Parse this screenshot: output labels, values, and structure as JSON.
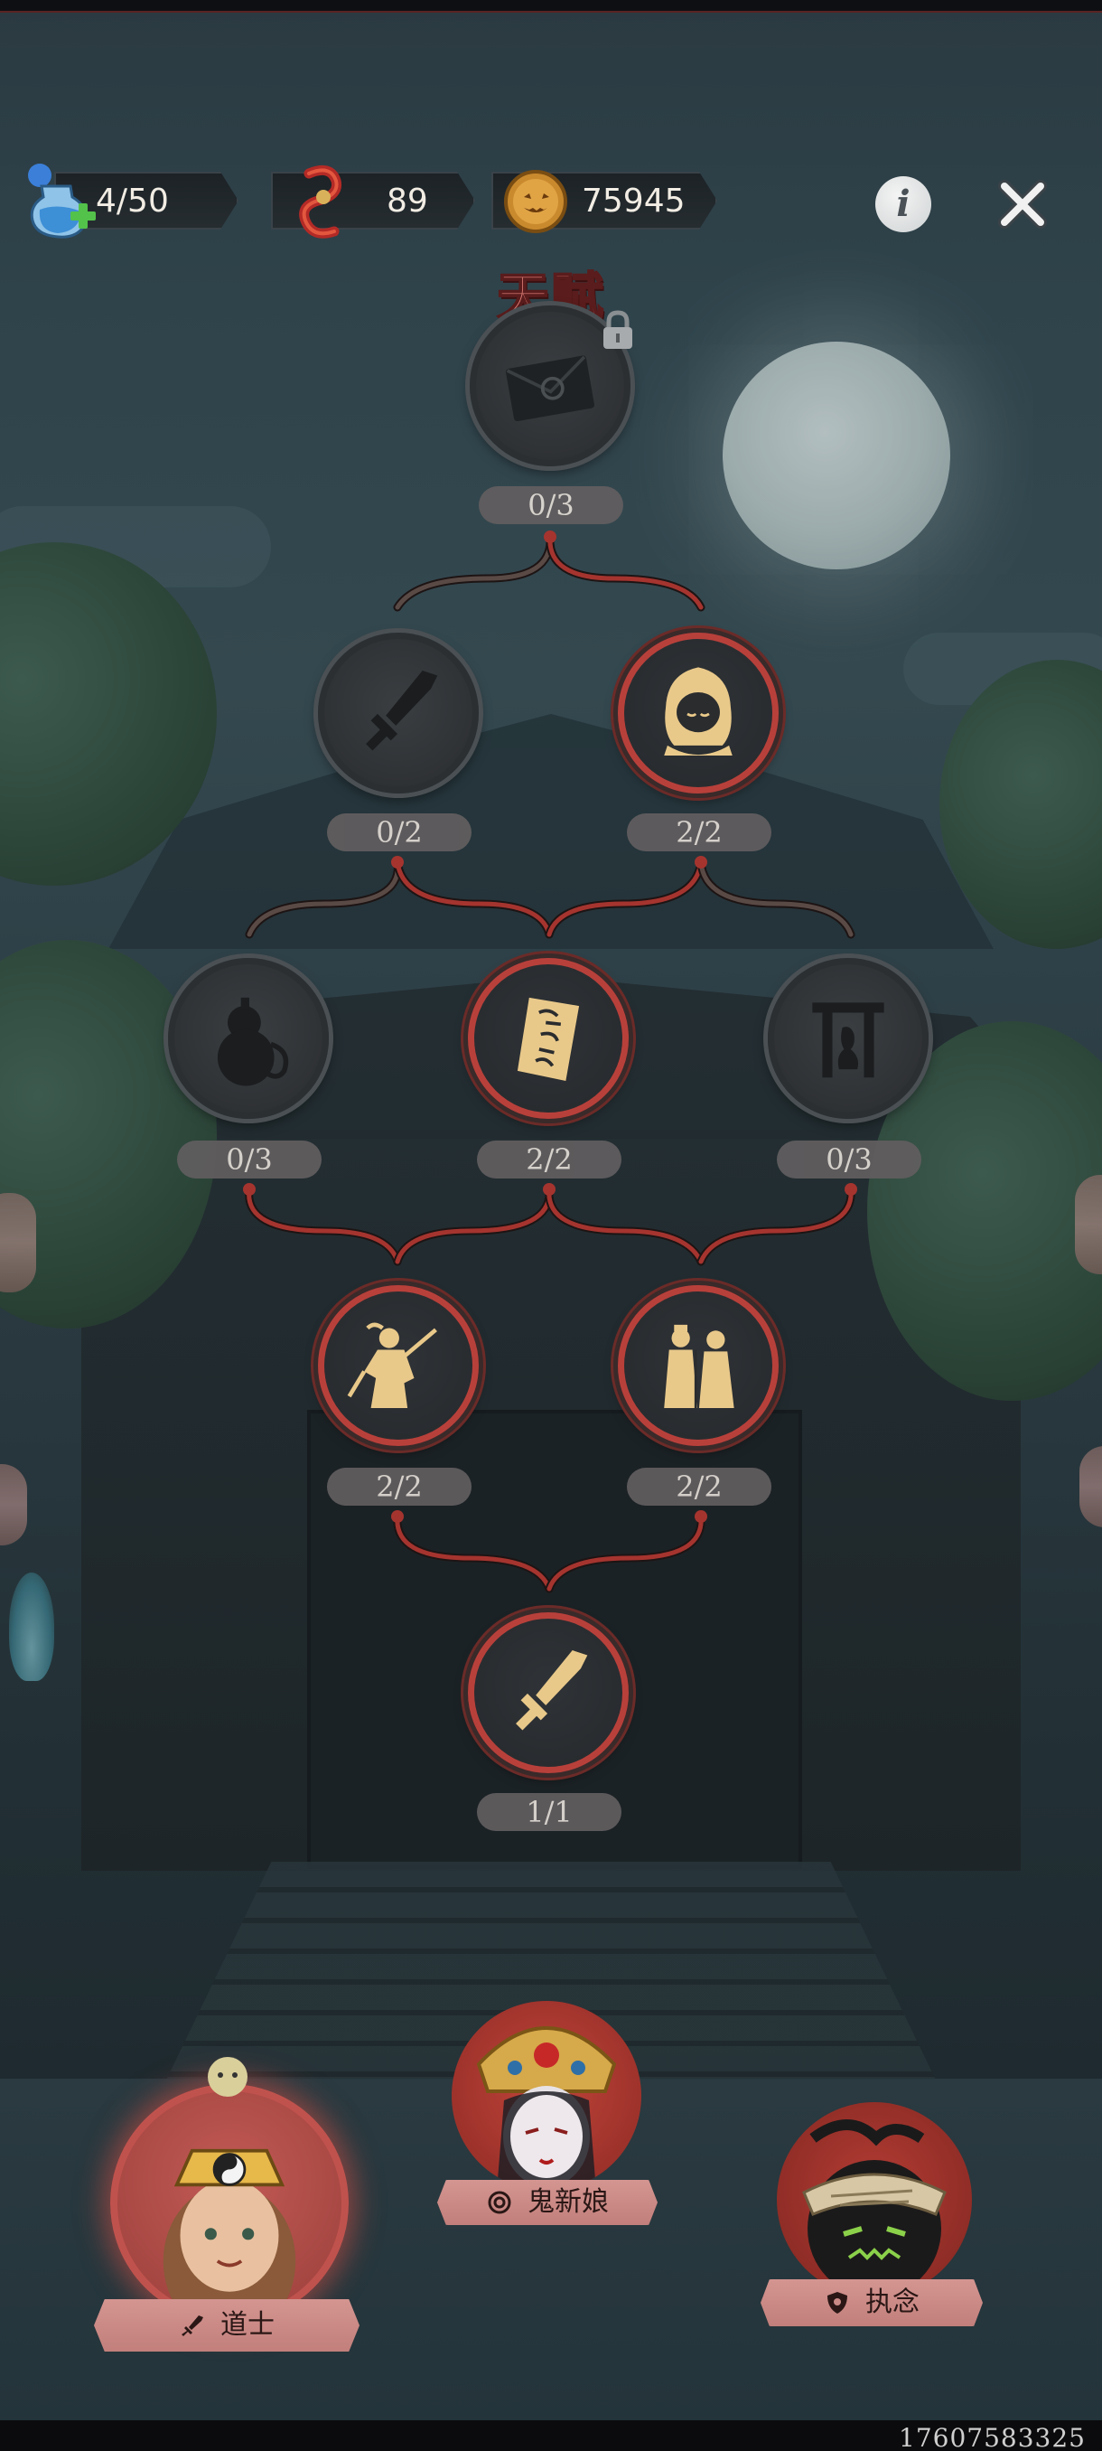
{
  "resources": {
    "stamina": {
      "value": "4/50",
      "icon": "potion-plus-icon"
    },
    "tokens": {
      "value": "89",
      "icon": "red-chain-icon"
    },
    "coins": {
      "value": "75945",
      "icon": "pumpkin-coin-icon"
    }
  },
  "top_buttons": {
    "info_glyph": "i",
    "close_icon": "close-icon"
  },
  "title": "天赋",
  "talents": [
    {
      "id": "envelope",
      "progress": "0/3",
      "state": "inactive",
      "locked": true,
      "icon": "envelope-icon"
    },
    {
      "id": "sword-a",
      "progress": "0/2",
      "state": "inactive",
      "icon": "sword-icon"
    },
    {
      "id": "hood",
      "progress": "2/2",
      "state": "active",
      "icon": "hooded-figure-icon"
    },
    {
      "id": "gourd",
      "progress": "0/3",
      "state": "inactive",
      "icon": "gourd-icon"
    },
    {
      "id": "talisman",
      "progress": "2/2",
      "state": "active",
      "icon": "talisman-icon"
    },
    {
      "id": "shrine",
      "progress": "0/3",
      "state": "inactive",
      "icon": "shrine-icon"
    },
    {
      "id": "swordsman",
      "progress": "2/2",
      "state": "active",
      "icon": "swordsman-icon"
    },
    {
      "id": "couple",
      "progress": "2/2",
      "state": "active",
      "icon": "couple-icon"
    },
    {
      "id": "sword-b",
      "progress": "1/1",
      "state": "active",
      "icon": "sword-icon"
    }
  ],
  "characters": [
    {
      "name": "道士",
      "role_icon": "sword-icon",
      "selected": true
    },
    {
      "name": "鬼新娘",
      "role_icon": "spiral-icon",
      "selected": false
    },
    {
      "name": "执念",
      "role_icon": "shield-icon",
      "selected": false
    }
  ],
  "watermark": "17607583325",
  "colors": {
    "active_ring": "#b8403b",
    "link_active": "#a5342f",
    "link_inactive": "#5a4a46",
    "icon_gold": "#e9c98a",
    "title_red": "#e6857e"
  }
}
